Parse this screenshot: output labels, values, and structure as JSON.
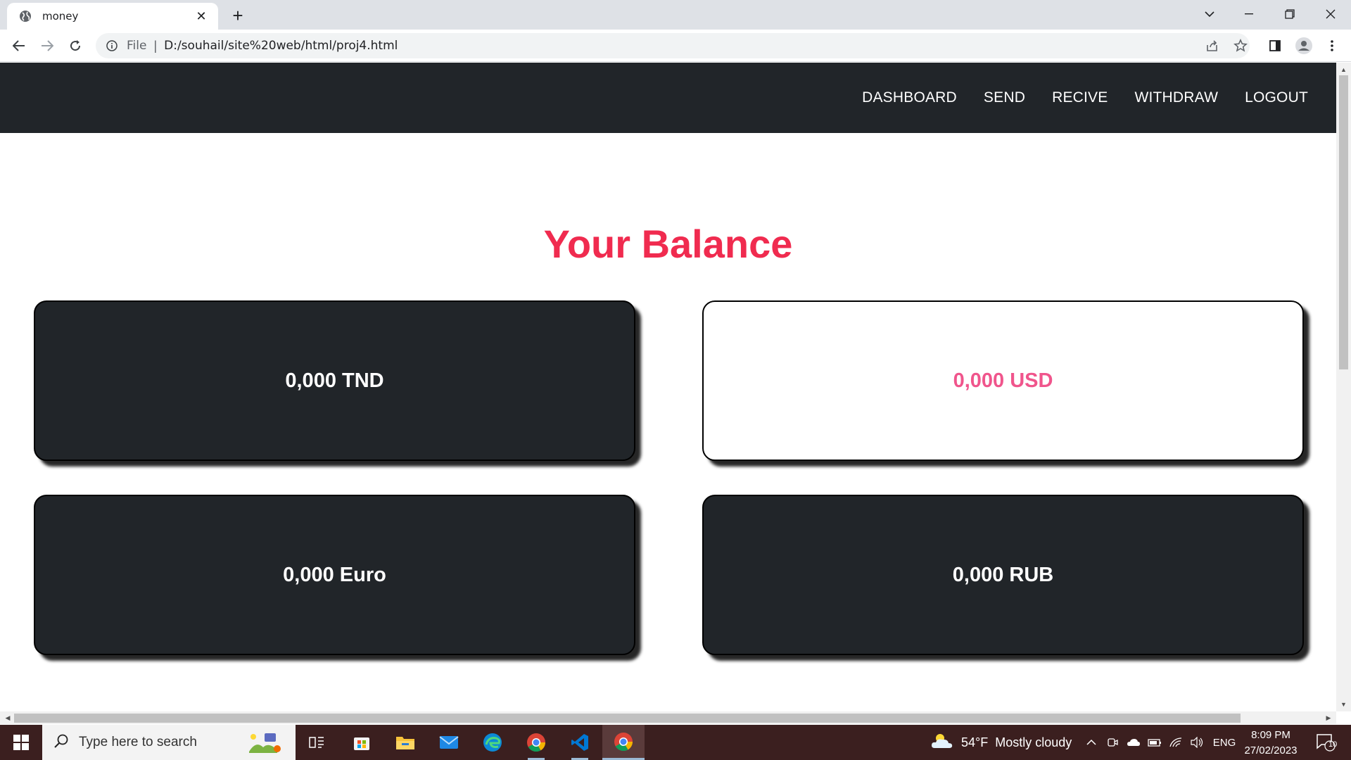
{
  "browser": {
    "tab_title": "money",
    "url_scheme": "File",
    "url": "D:/souhail/site%20web/html/proj4.html"
  },
  "nav": {
    "links": [
      "DASHBOARD",
      "SEND",
      "RECIVE",
      "WITHDRAW",
      "LOGOUT"
    ]
  },
  "page": {
    "heading": "Your Balance",
    "cards": [
      {
        "label": "0,000 TND",
        "style": "dark"
      },
      {
        "label": "0,000 USD",
        "style": "light"
      },
      {
        "label": "0,000 Euro",
        "style": "dark"
      },
      {
        "label": "0,000 RUB",
        "style": "dark"
      }
    ]
  },
  "colors": {
    "navbar_bg": "#212529",
    "heading": "#f02b4f",
    "usd_text": "#f0558c",
    "card_dark": "#212529"
  },
  "taskbar": {
    "search_placeholder": "Type here to search",
    "weather_temp": "54°F",
    "weather_desc": "Mostly cloudy",
    "language": "ENG",
    "time": "8:09 PM",
    "date": "27/02/2023",
    "notification_count": "10"
  }
}
